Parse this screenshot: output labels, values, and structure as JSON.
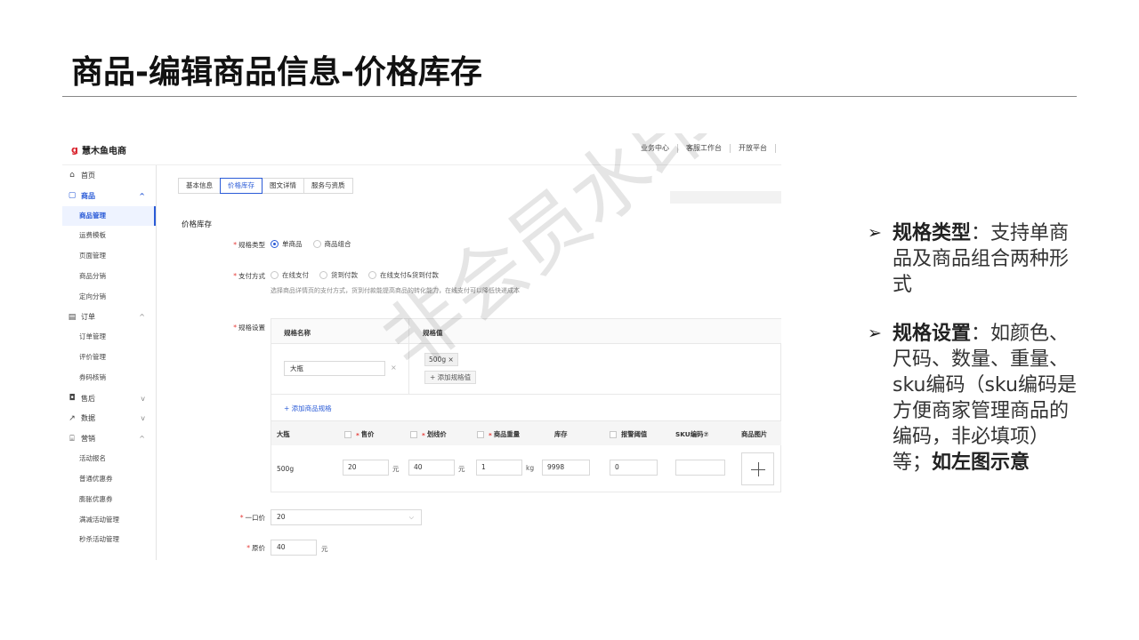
{
  "slide": {
    "title": "商品-编辑商品信息-价格库存"
  },
  "app": {
    "logo": "慧木鱼电商",
    "top_links": [
      "业务中心",
      "客服工作台",
      "开放平台"
    ],
    "sidebar": [
      {
        "type": "group",
        "icon": "home-icon",
        "glyph": "⌂",
        "label": "首页",
        "chev": ""
      },
      {
        "type": "group",
        "icon": "goods-icon",
        "glyph": "▢",
        "label": "商品",
        "chev": "^",
        "active": true
      },
      {
        "type": "item",
        "label": "商品管理",
        "active": true
      },
      {
        "type": "item",
        "label": "运费模板"
      },
      {
        "type": "item",
        "label": "页面管理"
      },
      {
        "type": "item",
        "label": "商品分销"
      },
      {
        "type": "item",
        "label": "定向分销"
      },
      {
        "type": "group",
        "icon": "order-icon",
        "glyph": "▤",
        "label": "订单",
        "chev": "^"
      },
      {
        "type": "item",
        "label": "订单管理"
      },
      {
        "type": "item",
        "label": "评价管理"
      },
      {
        "type": "item",
        "label": "券码核销"
      },
      {
        "type": "group",
        "icon": "aftersale-icon",
        "glyph": "◘",
        "label": "售后",
        "chev": "v"
      },
      {
        "type": "group",
        "icon": "data-icon",
        "glyph": "↗",
        "label": "数据",
        "chev": "v"
      },
      {
        "type": "group",
        "icon": "marketing-icon",
        "glyph": "⌸",
        "label": "营销",
        "chev": "^"
      },
      {
        "type": "item",
        "label": "活动报名"
      },
      {
        "type": "item",
        "label": "普通优惠券"
      },
      {
        "type": "item",
        "label": "膨胀优惠券"
      },
      {
        "type": "item",
        "label": "满减活动管理"
      },
      {
        "type": "item",
        "label": "秒杀活动管理"
      }
    ],
    "tabs": [
      "基本信息",
      "价格库存",
      "图文详情",
      "服务与资质"
    ],
    "section_title": "价格库存",
    "spec_type": {
      "label": "规格类型",
      "options": [
        "单商品",
        "商品组合"
      ]
    },
    "payment": {
      "label": "支付方式",
      "options": [
        "在线支付",
        "货到付款",
        "在线支付&货到付款"
      ],
      "hint": "选择商品详情页的支付方式，货到付款能提高商品的转化能力，在线支付可以降低快递成本"
    },
    "spec_setting": {
      "label": "规格设置",
      "col_name": "规格名称",
      "col_value": "规格值",
      "name_value": "大瓶",
      "remove": "×",
      "tag": "500g ×",
      "add_value": "+ 添加规格值",
      "add_spec": "+ 添加商品规格"
    },
    "sku_table": {
      "headers": [
        "大瓶",
        "售价",
        "划线价",
        "商品重量",
        "库存",
        "报警阈值",
        "SKU编码⑦",
        "商品图片"
      ],
      "row_label": "500g",
      "price": "20",
      "price_unit": "元",
      "strike_price": "40",
      "strike_unit": "元",
      "weight": "1",
      "weight_unit": "kg",
      "stock": "9998",
      "alert": "0",
      "sku_code": ""
    },
    "one_price": {
      "label": "一口价",
      "value": "20"
    },
    "original_price": {
      "label": "原价",
      "value": "40",
      "unit": "元"
    },
    "watermark": "非会员水印"
  },
  "notes": [
    {
      "bullet": "➢",
      "head": "规格类型",
      "body": "：支持单商品及商品组合两种形式",
      "tail": ""
    },
    {
      "bullet": "➢",
      "head": "规格设置",
      "body": "：如颜色、尺码、数量、重量、sku编码（sku编码是方便商家管理商品的编码，非必填项）等；",
      "tail": "如左图示意"
    }
  ],
  "colors": {
    "accent": "#2a5bd7",
    "required": "#e53935",
    "logo": "#d9232d"
  }
}
